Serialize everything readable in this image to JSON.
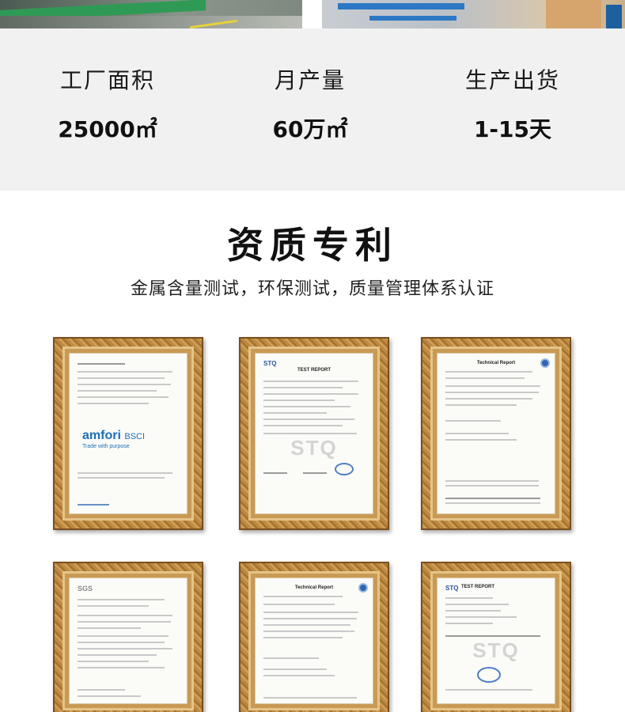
{
  "stats": [
    {
      "label": "工厂面积",
      "value": "25000㎡"
    },
    {
      "label": "月产量",
      "value": "60万㎡"
    },
    {
      "label": "生产出货",
      "value": "1-15天"
    }
  ],
  "section": {
    "title": "资质专利",
    "subtitle": "金属含量测试，环保测试，质量管理体系认证"
  },
  "certificates": [
    {
      "logo": "amfori",
      "logo_suffix": "BSCI",
      "tagline": "Trade with purpose"
    },
    {
      "logo": "STQ",
      "heading": "TEST REPORT",
      "watermark": "STQ"
    },
    {
      "heading": "Technical Report",
      "badge": "blue-seal-icon"
    },
    {
      "logo": "SGS"
    },
    {
      "heading": "Technical Report",
      "badge": "blue-seal-icon"
    },
    {
      "logo": "STQ",
      "heading": "TEST REPORT",
      "watermark": "STQ"
    }
  ],
  "colors": {
    "stats_background": "#f1f1f1",
    "frame_gold": "#b07a35",
    "amfori_blue": "#1f6fb6"
  }
}
